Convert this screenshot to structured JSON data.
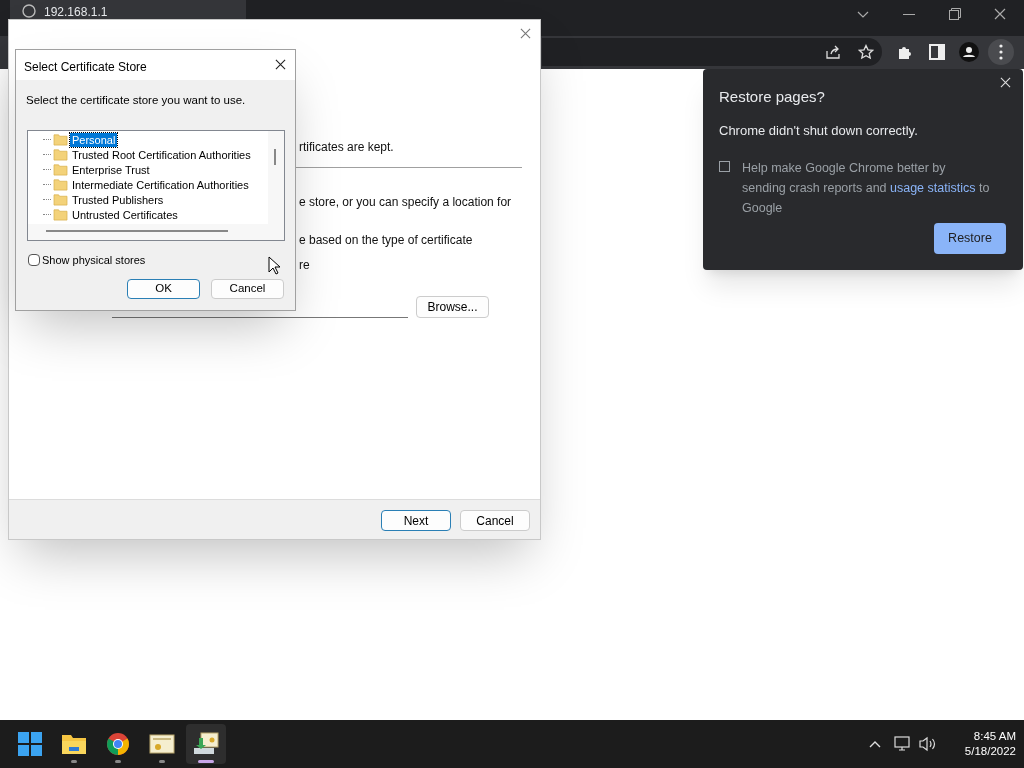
{
  "browser": {
    "tab_title": "192.168.1.1"
  },
  "wizard": {
    "fragments": [
      "rtificates are kept.",
      "e store, or you can specify a location for",
      "e based on the type of certificate",
      "re"
    ],
    "browse_button": "Browse...",
    "next_button": "Next",
    "cancel_button": "Cancel"
  },
  "dialog": {
    "title": "Select Certificate Store",
    "instruction": "Select the certificate store you want to use.",
    "stores": [
      {
        "label": "Personal",
        "selected": true
      },
      {
        "label": "Trusted Root Certification Authorities",
        "selected": false
      },
      {
        "label": "Enterprise Trust",
        "selected": false
      },
      {
        "label": "Intermediate Certification Authorities",
        "selected": false
      },
      {
        "label": "Trusted Publishers",
        "selected": false
      },
      {
        "label": "Untrusted Certificates",
        "selected": false
      }
    ],
    "show_physical": {
      "label": "Show physical stores",
      "checked": false
    },
    "ok_button": "OK",
    "cancel_button": "Cancel"
  },
  "restore_popup": {
    "title": "Restore pages?",
    "message": "Chrome didn't shut down correctly.",
    "consent": {
      "before": "Help make Google Chrome better by sending crash reports and ",
      "link": "usage statistics",
      "after": " to Google",
      "checked": false
    },
    "restore_button": "Restore"
  },
  "taskbar": {
    "apps": [
      {
        "kind": "start",
        "active": false
      },
      {
        "kind": "explorer",
        "active": false
      },
      {
        "kind": "chrome",
        "active": false
      },
      {
        "kind": "certificate",
        "active": false
      },
      {
        "kind": "cert-import",
        "active": true
      }
    ],
    "time": "8:45 AM",
    "date": "5/18/2022"
  }
}
